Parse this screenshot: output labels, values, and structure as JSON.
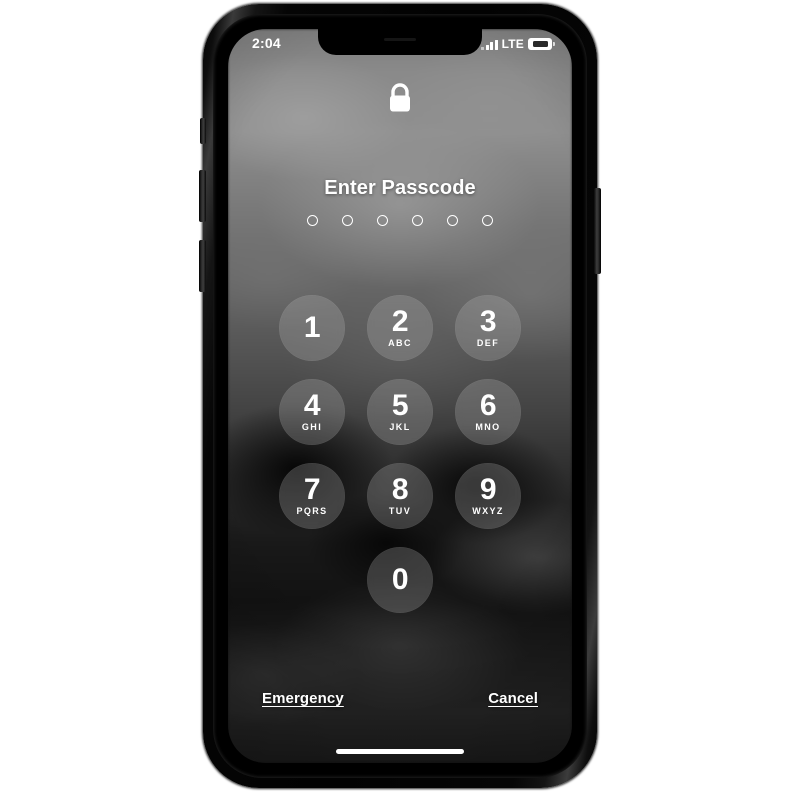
{
  "device": {
    "name": "iphone",
    "hardware_buttons": [
      {
        "name": "silent-switch"
      },
      {
        "name": "volume-up-button"
      },
      {
        "name": "volume-down-button"
      },
      {
        "name": "side-power-button"
      }
    ]
  },
  "status_bar": {
    "time": "2:04",
    "carrier_label": "LTE",
    "signal_icon": "signal-bars-icon",
    "signal_bars": 4,
    "battery_icon": "battery-icon"
  },
  "lock_screen": {
    "lock_icon": "lock-closed-icon",
    "prompt": "Enter Passcode",
    "passcode": {
      "length": 6,
      "entered": 0,
      "dots": [
        "empty",
        "empty",
        "empty",
        "empty",
        "empty",
        "empty"
      ]
    },
    "keypad": {
      "rows": [
        [
          {
            "digit": "1",
            "letters": ""
          },
          {
            "digit": "2",
            "letters": "ABC"
          },
          {
            "digit": "3",
            "letters": "DEF"
          }
        ],
        [
          {
            "digit": "4",
            "letters": "GHI"
          },
          {
            "digit": "5",
            "letters": "JKL"
          },
          {
            "digit": "6",
            "letters": "MNO"
          }
        ],
        [
          {
            "digit": "7",
            "letters": "PQRS"
          },
          {
            "digit": "8",
            "letters": "TUV"
          },
          {
            "digit": "9",
            "letters": "WXYZ"
          }
        ],
        [
          {
            "digit": "0",
            "letters": ""
          }
        ]
      ]
    },
    "actions": {
      "emergency_label": "Emergency",
      "cancel_label": "Cancel"
    },
    "home_indicator": "home-indicator"
  },
  "colors": {
    "text": "#ffffff",
    "key_fill": "rgba(190,190,190,0.26)",
    "frame": "#000000"
  }
}
